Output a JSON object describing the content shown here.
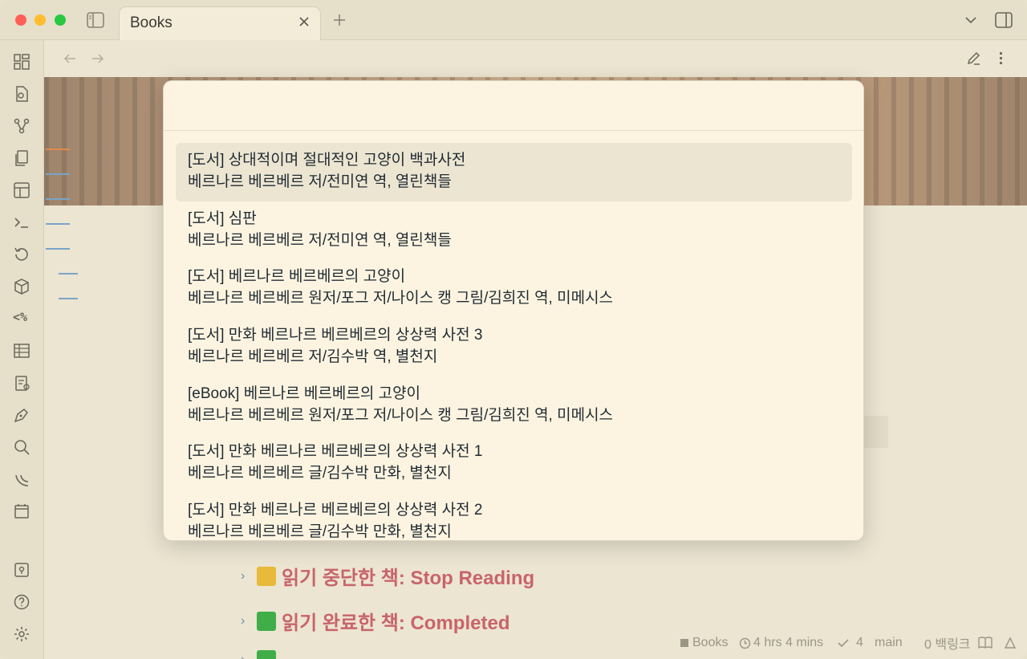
{
  "tab": {
    "title": "Books"
  },
  "search": {
    "value": "",
    "placeholder": ""
  },
  "results": [
    {
      "title": "[도서] 상대적이며 절대적인 고양이 백과사전",
      "subtitle": "베르나르 베르베르 저/전미연 역, 열린책들",
      "selected": true
    },
    {
      "title": "[도서] 심판",
      "subtitle": "베르나르 베르베르 저/전미연 역, 열린책들"
    },
    {
      "title": "[도서] 베르나르 베르베르의 고양이",
      "subtitle": "베르나르 베르베르 원저/포그 저/나이스 캥 그림/김희진 역, 미메시스"
    },
    {
      "title": "[도서] 만화 베르나르 베르베르의 상상력 사전 3",
      "subtitle": "베르나르 베르베르 저/김수박 역, 별천지"
    },
    {
      "title": "[eBook] 베르나르 베르베르의 고양이",
      "subtitle": "베르나르 베르베르 원저/포그 저/나이스 캥 그림/김희진 역, 미메시스"
    },
    {
      "title": "[도서] 만화 베르나르 베르베르의 상상력 사전 1",
      "subtitle": "베르나르 베르베르 글/김수박 만화, 별천지"
    },
    {
      "title": "[도서] 만화 베르나르 베르베르의 상상력 사전 2",
      "subtitle": "베르나르 베르베르 글/김수박 만화, 별천지"
    }
  ],
  "headings": [
    {
      "label": "읽기 중단한 책: Stop Reading",
      "color": "#e8b93a"
    },
    {
      "label": "읽기 완료한 책: Completed",
      "color": "#3fae49"
    }
  ],
  "status": {
    "file": "Books",
    "time": "4 hrs 4 mins",
    "count": "4",
    "branch": "main",
    "backlinks": "0 백링크"
  },
  "colors": {
    "accent_heading": "#c8646a",
    "ribbon_bg": "#e6dfca",
    "modal_bg": "#fcf4e0"
  }
}
